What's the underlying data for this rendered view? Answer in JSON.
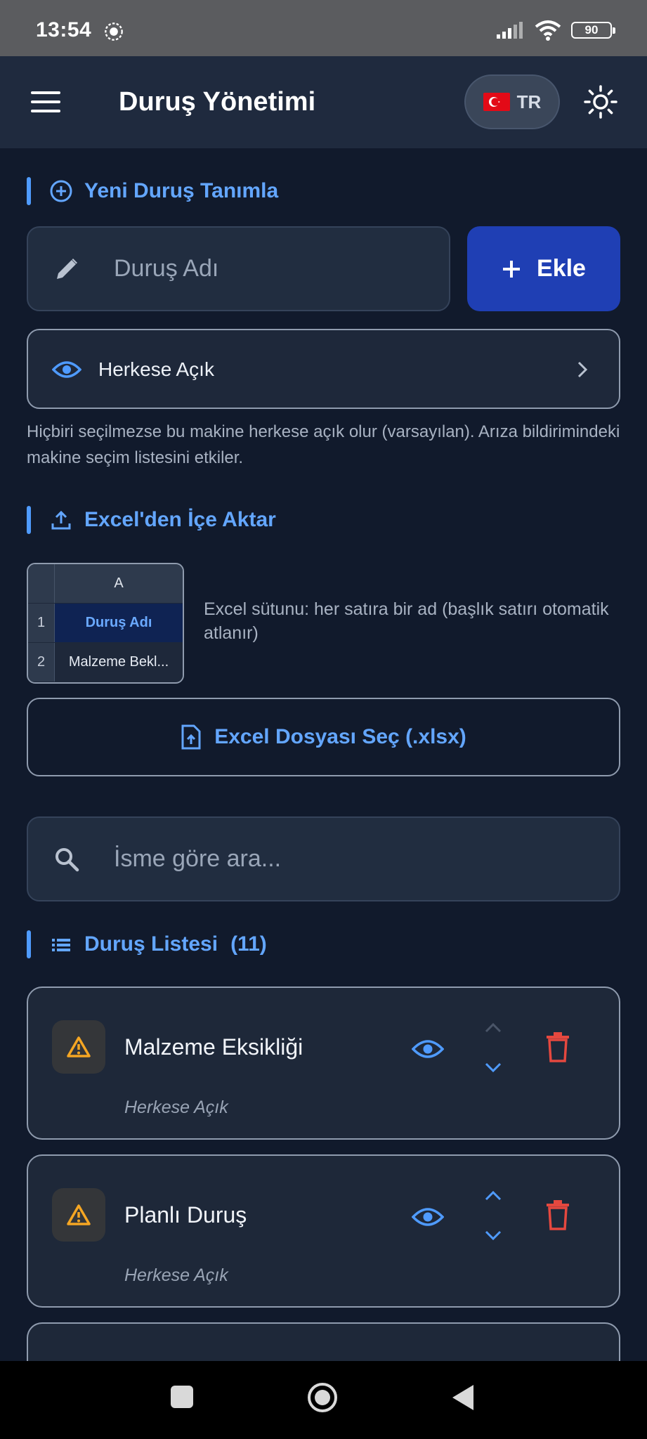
{
  "status_bar": {
    "time": "13:54",
    "battery": "90"
  },
  "header": {
    "title": "Duruş Yönetimi",
    "language": "TR"
  },
  "new_stop": {
    "section_title": "Yeni Duruş Tanımla",
    "name_placeholder": "Duruş Adı",
    "add_label": "Ekle",
    "visibility_label": "Herkese Açık",
    "help_text": "Hiçbiri seçilmezse bu makine herkese açık olur (varsayılan). Arıza bildirimindeki makine seçim listesini etkiler."
  },
  "excel_import": {
    "section_title": "Excel'den İçe Aktar",
    "preview": {
      "column_header": "A",
      "rows": [
        {
          "num": "1",
          "value": "Duruş Adı"
        },
        {
          "num": "2",
          "value": "Malzeme Bekl..."
        }
      ]
    },
    "description": "Excel sütunu: her satıra bir ad (başlık satırı otomatik atlanır)",
    "select_button": "Excel Dosyası Seç (.xlsx)"
  },
  "search": {
    "placeholder": "İsme göre ara..."
  },
  "stop_list": {
    "section_title": "Duruş Listesi",
    "count": "(11)",
    "items": [
      {
        "name": "Malzeme Eksikliği",
        "visibility": "Herkese Açık"
      },
      {
        "name": "Planlı Duruş",
        "visibility": "Herkese Açık"
      }
    ]
  },
  "colors": {
    "background": "#111a2c",
    "accent": "#63a6ff",
    "primary_button": "#1f3fb4",
    "warning": "#f5a623",
    "danger": "#e5483f"
  },
  "icons": {
    "menu": "menu-icon",
    "theme": "sun-icon",
    "add_circle": "add-circle-icon",
    "pencil": "pencil-icon",
    "eye": "eye-icon",
    "upload": "upload-icon",
    "file_upload": "file-upload-icon",
    "search": "search-icon",
    "list": "list-icon",
    "warning": "warning-icon",
    "trash": "trash-icon"
  }
}
